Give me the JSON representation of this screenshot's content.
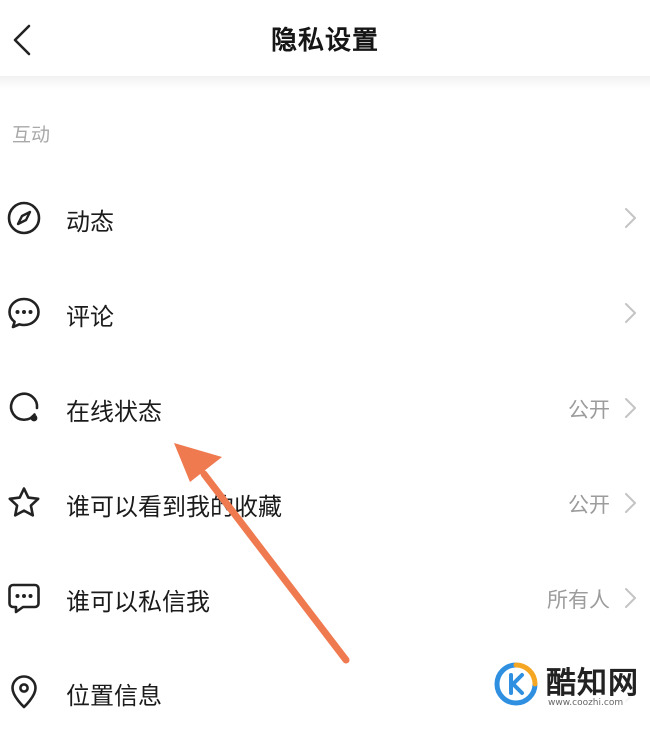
{
  "header": {
    "title": "隐私设置",
    "back_icon": "chevron-left-icon"
  },
  "section": {
    "label": "互动"
  },
  "items": [
    {
      "label": "动态",
      "value": "",
      "icon": "compass-icon"
    },
    {
      "label": "评论",
      "value": "",
      "icon": "chat-bubble-icon"
    },
    {
      "label": "在线状态",
      "value": "公开",
      "icon": "online-status-icon"
    },
    {
      "label": "谁可以看到我的收藏",
      "value": "公开",
      "icon": "star-icon"
    },
    {
      "label": "谁可以私信我",
      "value": "所有人",
      "icon": "message-icon"
    },
    {
      "label": "位置信息",
      "value": "",
      "icon": "location-pin-icon"
    }
  ],
  "watermark": {
    "name": "酷知网",
    "url": "www.coozhi.com"
  },
  "colors": {
    "annotation_arrow": "#f07a50",
    "logo_blue": "#2f8fe0",
    "logo_orange": "#f5a623"
  }
}
